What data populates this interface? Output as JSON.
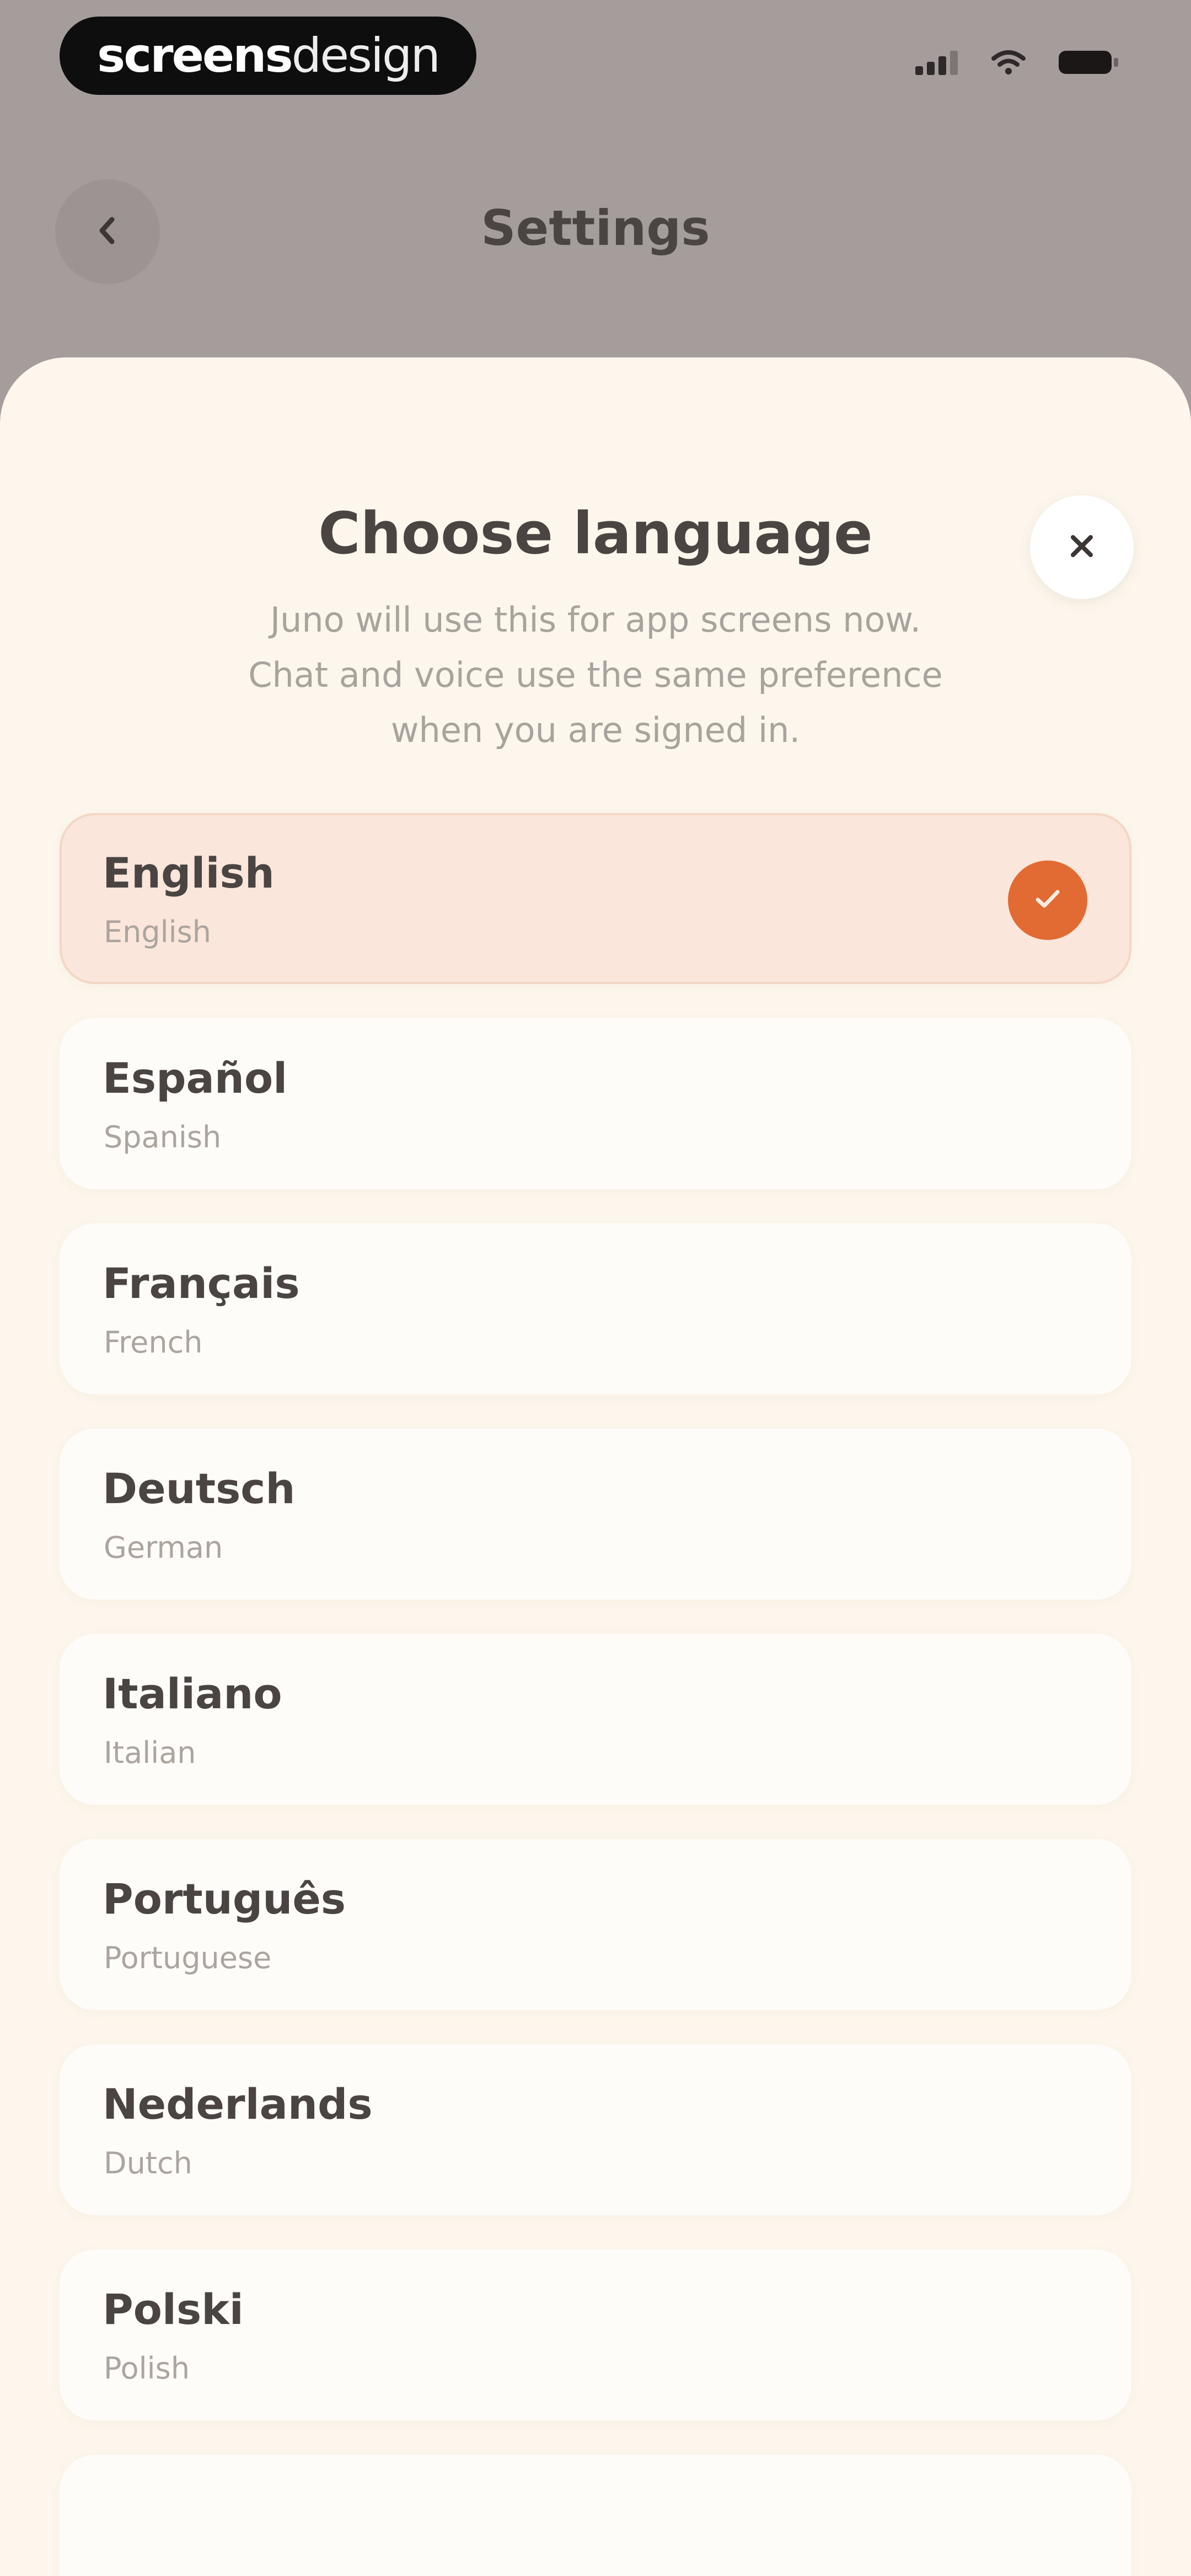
{
  "brand": {
    "part1": "screens",
    "part2": "design"
  },
  "status_bar": {
    "icons": [
      "signal-icon",
      "wifi-icon",
      "battery-icon"
    ]
  },
  "header": {
    "title": "Settings",
    "back_icon": "chevron-left-icon"
  },
  "sheet": {
    "title": "Choose language",
    "subtitle_lines": [
      "Juno will use this for app screens now.",
      "Chat and voice use the same preference",
      "when you are signed in."
    ],
    "close_icon": "close-icon"
  },
  "languages": [
    {
      "name": "English",
      "english_name": "English",
      "selected": true
    },
    {
      "name": "Español",
      "english_name": "Spanish",
      "selected": false
    },
    {
      "name": "Français",
      "english_name": "French",
      "selected": false
    },
    {
      "name": "Deutsch",
      "english_name": "German",
      "selected": false
    },
    {
      "name": "Italiano",
      "english_name": "Italian",
      "selected": false
    },
    {
      "name": "Português",
      "english_name": "Portuguese",
      "selected": false
    },
    {
      "name": "Nederlands",
      "english_name": "Dutch",
      "selected": false
    },
    {
      "name": "Polski",
      "english_name": "Polish",
      "selected": false
    },
    {
      "name": "",
      "english_name": "",
      "selected": false
    }
  ],
  "colors": {
    "backdrop": "#a59d9c",
    "sheet_background": "#fcf6ec",
    "accent": "#e26a33",
    "selected_row": "#fbe6dc",
    "text_primary": "#4a4442",
    "text_secondary": "#aca59f"
  }
}
